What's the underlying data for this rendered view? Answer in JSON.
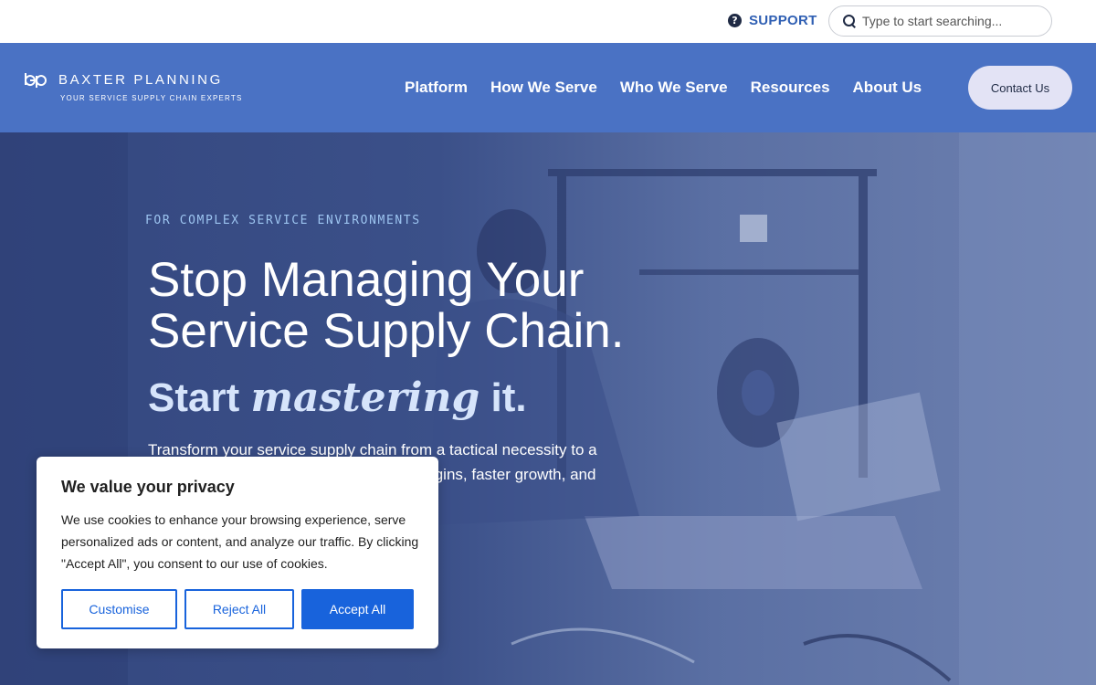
{
  "topbar": {
    "support_label": "SUPPORT",
    "support_icon": "question-circle-icon",
    "search_placeholder": "Type to start searching...",
    "search_icon": "search-icon"
  },
  "navbar": {
    "logo": {
      "name": "BAXTER PLANNING",
      "tagline": "YOUR SERVICE SUPPLY CHAIN EXPERTS"
    },
    "links": [
      "Platform",
      "How We Serve",
      "Who We Serve",
      "Resources",
      "About Us"
    ],
    "contact_label": "Contact Us"
  },
  "hero": {
    "eyebrow": "FOR COMPLEX SERVICE ENVIRONMENTS",
    "headline_line1": "Stop Managing Your",
    "headline_line2": "Service Supply Chain.",
    "subhead_start": "Start",
    "subhead_em": "mastering",
    "subhead_end": "it.",
    "description": "Transform your service supply chain from a tactical necessity to a strategic advantage that drives better margins, faster growth, and"
  },
  "cookie": {
    "title": "We value your privacy",
    "text": "We use cookies to enhance your browsing experience, serve personalized ads or content, and analyze our traffic. By clicking \"Accept All\", you consent to our use of cookies.",
    "customise_label": "Customise",
    "reject_label": "Reject All",
    "accept_label": "Accept All"
  },
  "colors": {
    "nav_bg": "#4a72c4",
    "support_text": "#2f5fb3",
    "accept_bg": "#1863dc",
    "contact_bg": "#e3e3f5"
  }
}
